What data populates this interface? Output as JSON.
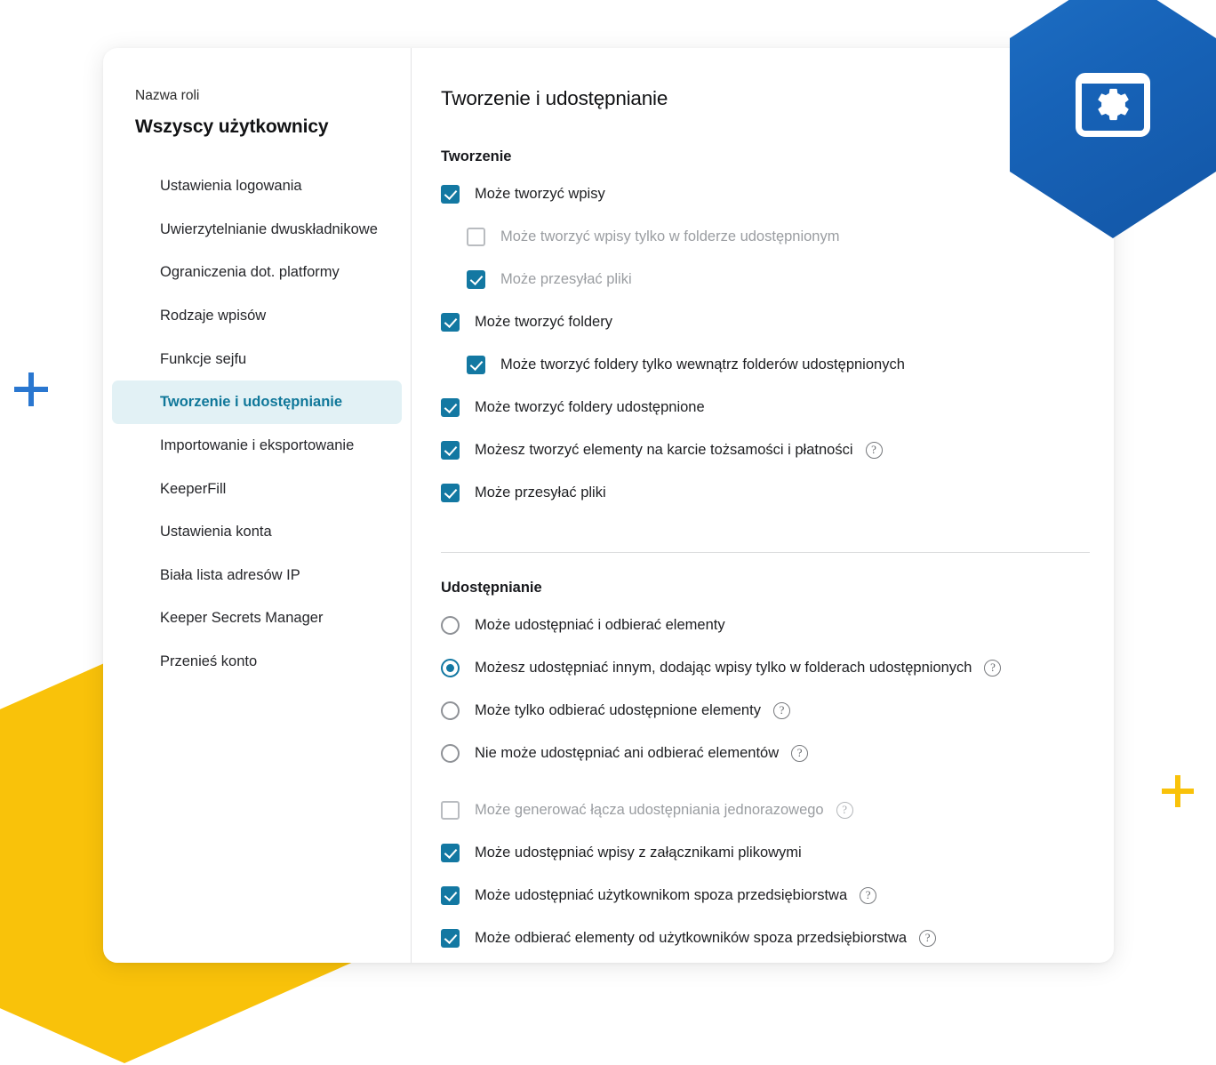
{
  "decor": {
    "hex_blue_color": "#1763b8",
    "hex_yellow_color": "#f9c20a",
    "plus_blue_color": "#2a77d0",
    "plus_yellow_color": "#f9c20a",
    "badge_icon": "window-gear-icon"
  },
  "theme": {
    "accent_teal": "#1378a2",
    "active_nav_bg": "#e2f1f5",
    "active_nav_text": "#0f7799"
  },
  "sidebar": {
    "role_label": "Nazwa roli",
    "role_name": "Wszyscy użytkownicy",
    "items": [
      {
        "label": "Ustawienia logowania",
        "active": false
      },
      {
        "label": "Uwierzytelnianie dwuskładnikowe",
        "active": false
      },
      {
        "label": "Ograniczenia dot. platformy",
        "active": false
      },
      {
        "label": "Rodzaje wpisów",
        "active": false
      },
      {
        "label": "Funkcje sejfu",
        "active": false
      },
      {
        "label": "Tworzenie i udostępnianie",
        "active": true
      },
      {
        "label": "Importowanie i eksportowanie",
        "active": false
      },
      {
        "label": "KeeperFill",
        "active": false
      },
      {
        "label": "Ustawienia konta",
        "active": false
      },
      {
        "label": "Biała lista adresów IP",
        "active": false
      },
      {
        "label": "Keeper Secrets Manager",
        "active": false
      },
      {
        "label": "Przenieś konto",
        "active": false
      }
    ]
  },
  "main": {
    "title": "Tworzenie i udostępnianie",
    "creation": {
      "heading": "Tworzenie",
      "options": [
        {
          "label": "Może tworzyć wpisy",
          "control": "checkbox",
          "checked": true,
          "indent": 0,
          "disabled": false,
          "help": false
        },
        {
          "label": "Może tworzyć wpisy tylko w folderze udostępnionym",
          "control": "checkbox",
          "checked": false,
          "indent": 1,
          "disabled": true,
          "help": false
        },
        {
          "label": "Może przesyłać pliki",
          "control": "checkbox",
          "checked": true,
          "indent": 1,
          "disabled": true,
          "help": false
        },
        {
          "label": "Może tworzyć foldery",
          "control": "checkbox",
          "checked": true,
          "indent": 0,
          "disabled": false,
          "help": false
        },
        {
          "label": "Może tworzyć foldery tylko wewnątrz folderów udostępnionych",
          "control": "checkbox",
          "checked": true,
          "indent": 1,
          "disabled": false,
          "help": false
        },
        {
          "label": "Może tworzyć foldery udostępnione",
          "control": "checkbox",
          "checked": true,
          "indent": 0,
          "disabled": false,
          "help": false
        },
        {
          "label": "Możesz tworzyć elementy na karcie tożsamości i płatności",
          "control": "checkbox",
          "checked": true,
          "indent": 0,
          "disabled": false,
          "help": true
        },
        {
          "label": "Może przesyłać pliki",
          "control": "checkbox",
          "checked": true,
          "indent": 0,
          "disabled": false,
          "help": false
        }
      ]
    },
    "sharing": {
      "heading": "Udostępnianie",
      "radio_options": [
        {
          "label": "Może udostępniać i odbierać elementy",
          "control": "radio",
          "checked": false,
          "indent": 0,
          "disabled": false,
          "help": false
        },
        {
          "label": "Możesz udostępniać innym, dodając wpisy tylko w folderach udostępnionych",
          "control": "radio",
          "checked": true,
          "indent": 0,
          "disabled": false,
          "help": true
        },
        {
          "label": "Może tylko odbierać udostępnione elementy",
          "control": "radio",
          "checked": false,
          "indent": 0,
          "disabled": false,
          "help": true
        },
        {
          "label": "Nie może udostępniać ani odbierać elementów",
          "control": "radio",
          "checked": false,
          "indent": 0,
          "disabled": false,
          "help": true
        }
      ],
      "checkbox_options": [
        {
          "label": "Może generować łącza udostępniania jednorazowego",
          "control": "checkbox",
          "checked": false,
          "indent": 0,
          "disabled": true,
          "help": true
        },
        {
          "label": "Może udostępniać wpisy z załącznikami plikowymi",
          "control": "checkbox",
          "checked": true,
          "indent": 0,
          "disabled": false,
          "help": false
        },
        {
          "label": "Może udostępniać użytkownikom spoza przedsiębiorstwa",
          "control": "checkbox",
          "checked": true,
          "indent": 0,
          "disabled": false,
          "help": true
        },
        {
          "label": "Może odbierać elementy od użytkowników spoza przedsiębiorstwa",
          "control": "checkbox",
          "checked": true,
          "indent": 0,
          "disabled": false,
          "help": true
        }
      ]
    },
    "help_glyph": "?"
  }
}
